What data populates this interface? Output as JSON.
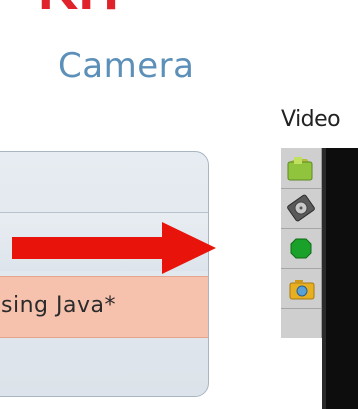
{
  "logo": {
    "top_text": "KIT",
    "camera_text": "Camera"
  },
  "menu": {
    "highlighted_item": "sing Java*"
  },
  "video": {
    "label": "Video"
  },
  "toolbar": {
    "buttons": [
      {
        "icon": "folder-icon"
      },
      {
        "icon": "hard-drive-icon"
      },
      {
        "icon": "green-status-icon"
      },
      {
        "icon": "camera-icon"
      }
    ]
  },
  "colors": {
    "arrow": "#e8140c",
    "highlight": "#f6c2ae",
    "logo_red": "#e0222b",
    "logo_blue": "#5d90b8"
  }
}
